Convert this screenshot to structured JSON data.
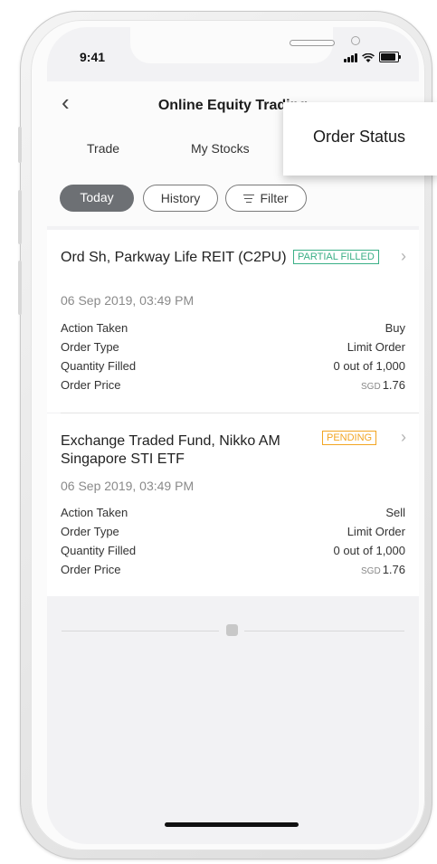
{
  "status_bar": {
    "time": "9:41"
  },
  "nav": {
    "back_icon": "‹",
    "title": "Online Equity Trading"
  },
  "tabs": [
    {
      "label": "Trade"
    },
    {
      "label": "My Stocks"
    }
  ],
  "popup": {
    "label": "Order Status"
  },
  "filters": {
    "today": "Today",
    "history": "History",
    "filter": "Filter",
    "active": "Today"
  },
  "orders": [
    {
      "title": "Ord Sh, Parkway Life REIT (C2PU)",
      "status": "PARTIAL FILLED",
      "status_color": "#3aaf86",
      "date": "06 Sep 2019, 03:49 PM",
      "rows": [
        {
          "label": "Action Taken",
          "value": "Buy"
        },
        {
          "label": "Order Type",
          "value": "Limit Order"
        },
        {
          "label": "Quantity Filled",
          "value": "0 out of 1,000"
        },
        {
          "label": "Order Price",
          "currency": "SGD",
          "value": "1.76"
        }
      ]
    },
    {
      "title": "Exchange Traded Fund, Nikko AM Singapore STI ETF",
      "status": "PENDING",
      "status_color": "#f2a522",
      "date": "06 Sep 2019, 03:49 PM",
      "rows": [
        {
          "label": "Action Taken",
          "value": "Sell"
        },
        {
          "label": "Order Type",
          "value": "Limit Order"
        },
        {
          "label": "Quantity Filled",
          "value": "0 out of 1,000"
        },
        {
          "label": "Order Price",
          "currency": "SGD",
          "value": "1.76"
        }
      ]
    }
  ],
  "icons": {
    "back": "chevron-left-icon",
    "chevron": "chevron-right-icon",
    "filter": "filter-icon",
    "end": "end-of-list-icon"
  }
}
